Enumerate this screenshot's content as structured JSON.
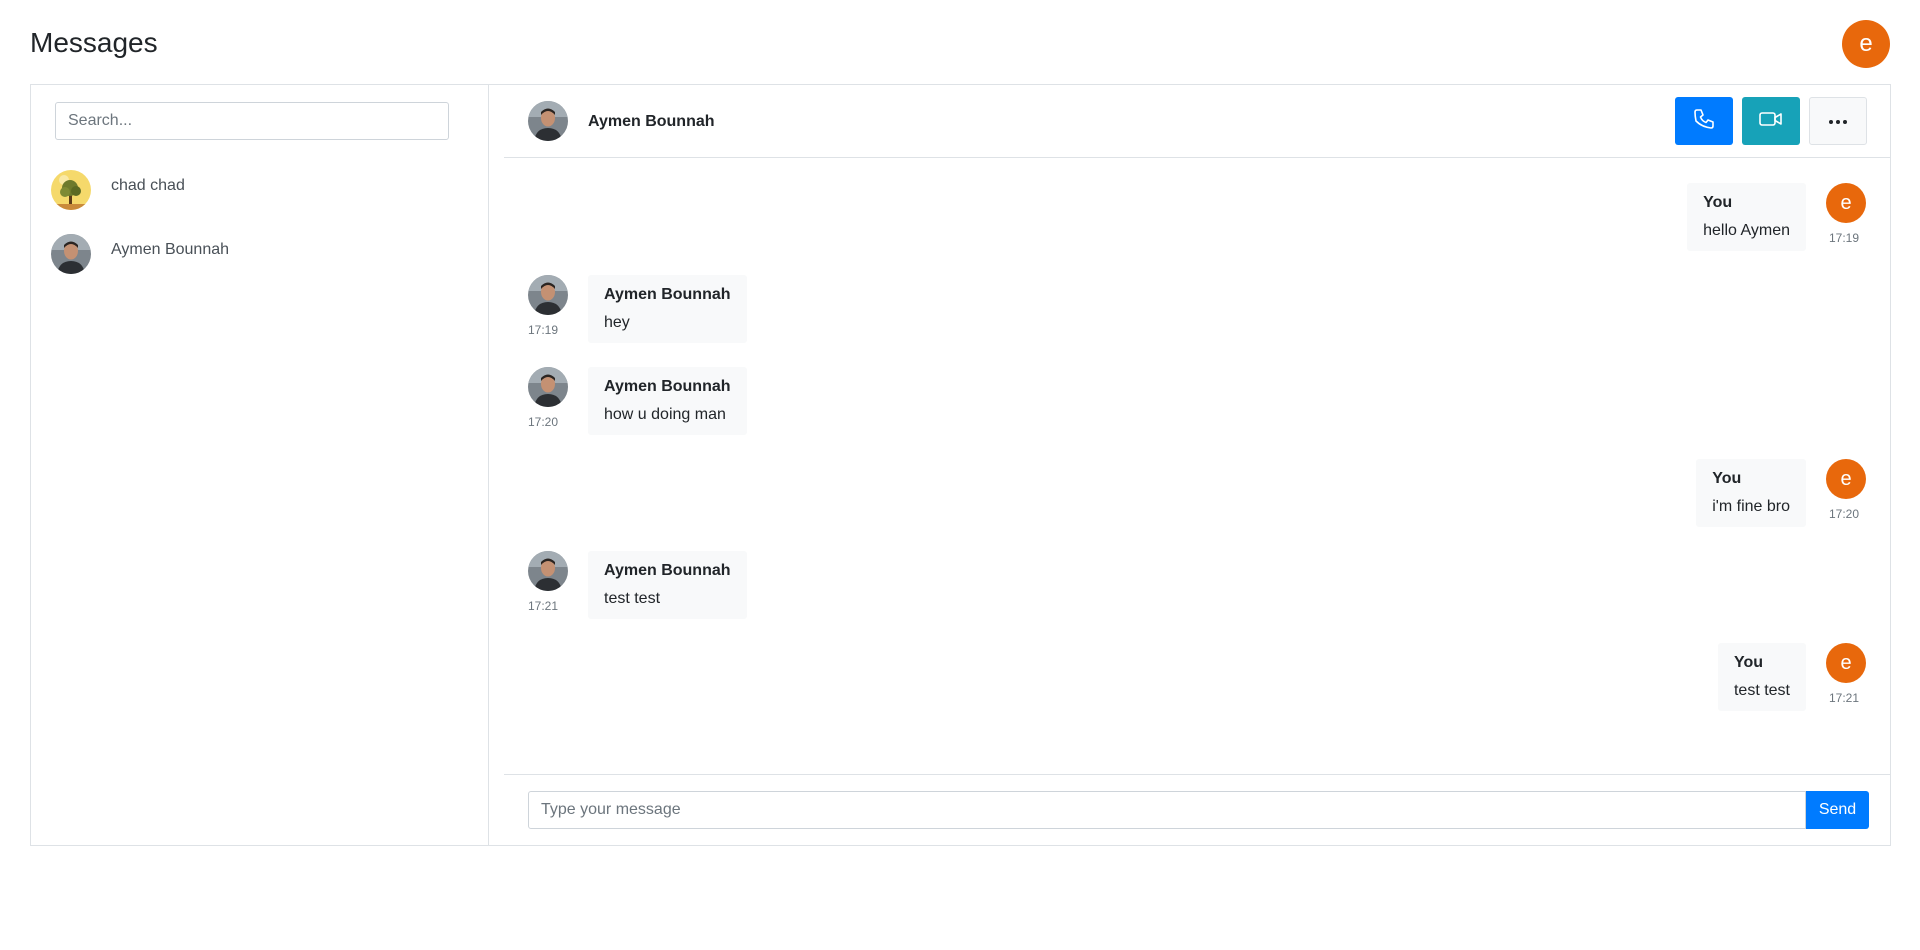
{
  "page": {
    "title": "Messages"
  },
  "user": {
    "avatar_letter": "e",
    "avatar_color": "#e8680c"
  },
  "sidebar": {
    "search_placeholder": "Search...",
    "contacts": [
      {
        "name": "chad chad",
        "avatar": "tree-photo"
      },
      {
        "name": "Aymen Bounnah",
        "avatar": "man-photo"
      }
    ]
  },
  "chat": {
    "contact_name": "Aymen Bounnah",
    "actions": {
      "call_icon": "phone-icon",
      "video_icon": "video-camera-icon",
      "more_icon": "more-horizontal-icon"
    },
    "messages": [
      {
        "from": "me",
        "sender": "You",
        "text": "hello Aymen",
        "time": "17:19"
      },
      {
        "from": "them",
        "sender": "Aymen Bounnah",
        "text": "hey",
        "time": "17:19"
      },
      {
        "from": "them",
        "sender": "Aymen Bounnah",
        "text": "how u doing man",
        "time": "17:20"
      },
      {
        "from": "me",
        "sender": "You",
        "text": "i'm fine bro",
        "time": "17:20"
      },
      {
        "from": "them",
        "sender": "Aymen Bounnah",
        "text": "test test",
        "time": "17:21"
      },
      {
        "from": "me",
        "sender": "You",
        "text": "test test",
        "time": "17:21"
      }
    ],
    "composer": {
      "placeholder": "Type your message",
      "send_label": "Send"
    }
  },
  "colors": {
    "primary": "#007bff",
    "info": "#17a2b8",
    "avatar": "#e8680c"
  }
}
